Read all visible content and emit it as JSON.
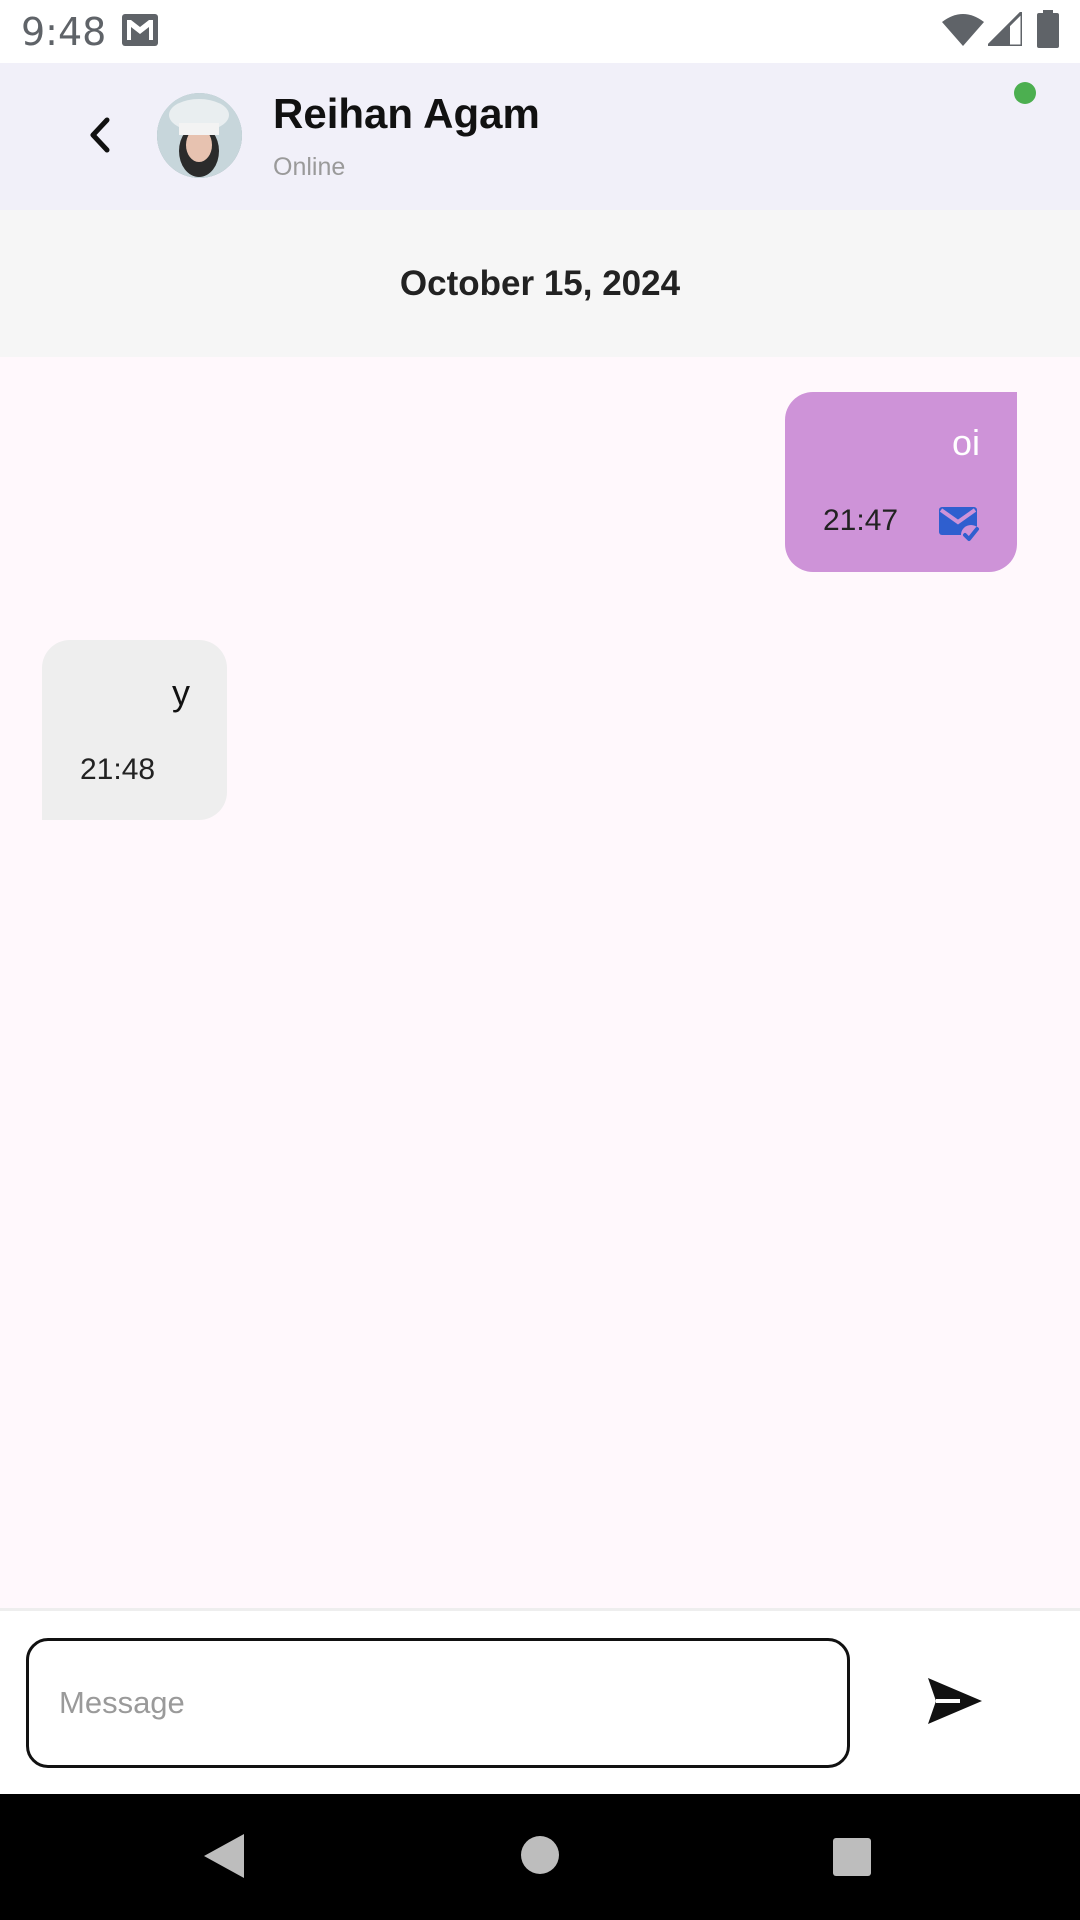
{
  "status_bar": {
    "time": "9:48",
    "icons": [
      "gmail-icon",
      "wifi-icon",
      "signal-icon",
      "battery-icon"
    ]
  },
  "header": {
    "back_icon": "chevron-left-icon",
    "contact_name": "Reihan Agam",
    "contact_status": "Online",
    "online_indicator_color": "#4CAF50"
  },
  "conversation": {
    "date": "October 15, 2024",
    "messages": [
      {
        "direction": "sent",
        "text": "oi",
        "time": "21:47",
        "status_icon": "mark-email-read-icon"
      },
      {
        "direction": "received",
        "text": "y",
        "time": "21:48"
      }
    ]
  },
  "composer": {
    "placeholder": "Message",
    "value": "",
    "send_icon": "send-icon"
  },
  "navigation": {
    "icons": [
      "nav-back-icon",
      "nav-home-icon",
      "nav-recents-icon"
    ]
  },
  "colors": {
    "sent_bubble": "#CE93D8",
    "received_bubble": "#EEEEEE",
    "app_bar": "#F1F0F9",
    "read_icon": "#2F5FCF"
  }
}
